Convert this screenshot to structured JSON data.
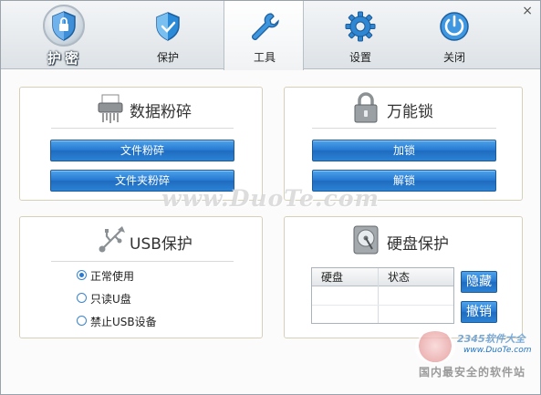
{
  "window": {
    "close_label": "×"
  },
  "logo": {
    "text": "护密"
  },
  "tabs": [
    {
      "label": "保护",
      "icon": "shield-icon"
    },
    {
      "label": "工具",
      "icon": "wrench-icon",
      "active": true
    },
    {
      "label": "设置",
      "icon": "gear-icon"
    },
    {
      "label": "关闭",
      "icon": "power-icon"
    }
  ],
  "shred": {
    "title": "数据粉碎",
    "icon": "shredder-icon",
    "buttons": [
      "文件粉碎",
      "文件夹粉碎"
    ]
  },
  "lock": {
    "title": "万能锁",
    "icon": "padlock-icon",
    "buttons": [
      "加锁",
      "解锁"
    ]
  },
  "usb": {
    "title": "USB保护",
    "icon": "usb-icon",
    "options": [
      {
        "label": "正常使用",
        "checked": true
      },
      {
        "label": "只读U盘",
        "checked": false
      },
      {
        "label": "禁止USB设备",
        "checked": false
      }
    ]
  },
  "disk": {
    "title": "硬盘保护",
    "icon": "harddisk-icon",
    "columns": [
      "硬盘",
      "状态"
    ],
    "buttons": {
      "hide": "隐藏",
      "cancel": "撤销"
    }
  },
  "watermarks": {
    "duote": "www.DuoTe.com",
    "site2345": "2345软件大全",
    "site2345_url": "www.DuoTe.com",
    "tagline": "国内最安全的软件站"
  },
  "colors": {
    "accent": "#2477cf",
    "panel_border": "#d7d0b9",
    "icon_blue": "#2a8ad8"
  }
}
